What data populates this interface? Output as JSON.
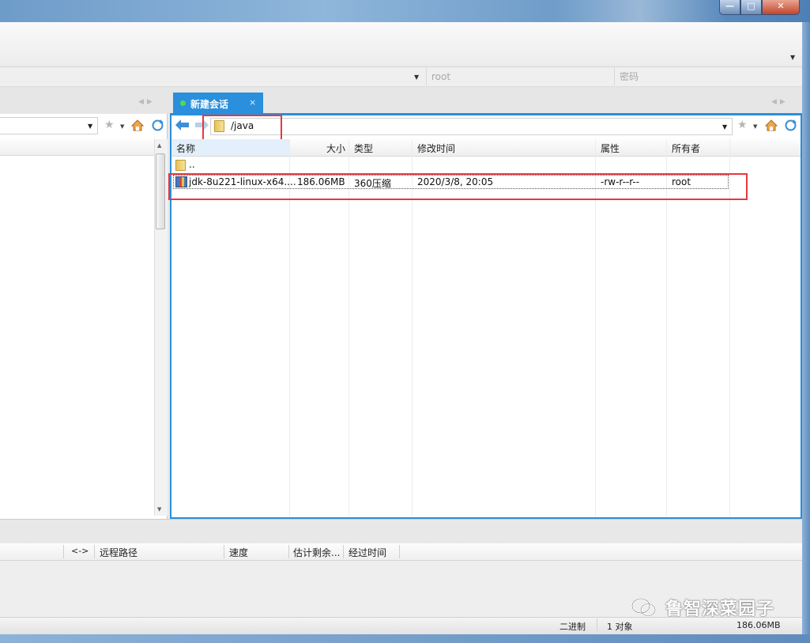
{
  "window": {
    "buttons": {
      "minimize": "—",
      "maximize": "□",
      "close": "✕"
    }
  },
  "connection": {
    "user_placeholder": "root",
    "password_placeholder": "密码"
  },
  "tabs": [
    {
      "label": "新建会话",
      "close": "×"
    }
  ],
  "remote": {
    "path": "/java",
    "columns": [
      "名称",
      "大小",
      "类型",
      "修改时间",
      "属性",
      "所有者"
    ],
    "rows": [
      {
        "name": "..",
        "size": "",
        "type": "",
        "modified": "",
        "attrs": "",
        "owner": ""
      },
      {
        "name": "jdk-8u221-linux-x64....",
        "size": "186.06MB",
        "type": "360压缩",
        "modified": "2020/3/8, 20:05",
        "attrs": "-rw-r--r--",
        "owner": "root"
      }
    ]
  },
  "transfer": {
    "columns": [
      "<->",
      "远程路径",
      "速度",
      "估计剩余...",
      "经过时间"
    ]
  },
  "status": {
    "mode": "二进制",
    "count": "1 对象",
    "size": "186.06MB"
  },
  "watermark": "鲁智深菜园子",
  "icons": {
    "back": "left-arrow-icon",
    "forward": "right-arrow-icon",
    "favorite": "star-icon",
    "home": "home-icon",
    "refresh": "refresh-icon",
    "folder": "folder-icon",
    "archive": "archive-icon"
  },
  "colors": {
    "accent": "#2a8fdc",
    "highlight": "#e8383d",
    "session_dot": "#4fdb4f"
  }
}
